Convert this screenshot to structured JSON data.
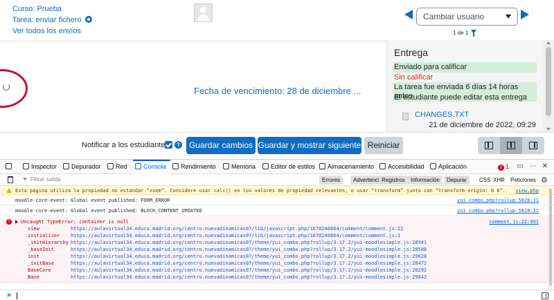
{
  "header": {
    "course_link": "Curso: Prueba",
    "task_link": "Tarea: enviar fichero",
    "view_all_link": "Ver todos los envíos",
    "change_user_placeholder": "Cambiar usuario",
    "pager_text": "1 de 1"
  },
  "submission": {
    "due_date": "Fecha de vencimiento: 28 de diciembre ...",
    "panel_title": "Entrega",
    "status_sent": "Enviado para calificar",
    "status_ungraded": "Sin calificar",
    "status_late": "La tarea fue enviada 6 días 14 horas antes",
    "status_editable": "El estudiante puede editar esta entrega",
    "file_name": "CHANGES.TXT",
    "file_date": "21 de diciembre de 2022, 09:29"
  },
  "actions": {
    "notify_label": "Notificar a los estudiantes",
    "notify_checked": true,
    "help_glyph": "?",
    "save_label": "Guardar cambios",
    "save_next_label": "Guardar y mostrar siguiente",
    "reset_label": "Reiniciar"
  },
  "devtools": {
    "tabs": {
      "inspector": "Inspector",
      "debugger": "Depurador",
      "network": "Red",
      "console": "Consola",
      "performance": "Rendimiento",
      "memory": "Memoria",
      "style_editor": "Editor de estilos",
      "storage": "Almacenamiento",
      "accessibility": "Accesibilidad",
      "application": "Aplicación"
    },
    "error_count": "1",
    "filter_placeholder": "Filtrar salida",
    "filter_toggles": {
      "errors": "Errores",
      "warnings": "Advertencias",
      "logs": "Registros",
      "info": "Información",
      "debug": "Depurar",
      "css": "CSS",
      "xhr": "XHR",
      "requests": "Peticiones"
    },
    "messages": {
      "warning_text": "Esta página utiliza la propiedad no estándar “zoom”. Considere usar calc() en los valores de propiedad relevantes, o usar “transform” junto con “transform-origin: 0 0”.",
      "warning_source": "view.php",
      "log1_text": "moodle-core-event: Global event published: FORM_ERROR",
      "log1_source": "yui_combo.php?rollup:5828:31",
      "log2_text": "moodle-core-event: Global event published: BLOCK_CONTENT_UPDATED",
      "log2_source": "yui_combo.php?rollup:5828:31",
      "error_text": "Uncaught TypeError: container is null",
      "error_source": "comment.js:22:991"
    },
    "stack_trace": [
      {
        "fn": "view",
        "url": "https://aulavirtual34.educa.madrid.org/centro.nuevadinamicas07/lib/javascript.php/1670240664/comment/comment.js:22"
      },
      {
        "fn": "initializer",
        "url": "https://aulavirtual34.educa.madrid.org/centro.nuevadinamicas07/lib/javascript.php/1670240664/comment/comment.js:1"
      },
      {
        "fn": "_initHierarchy",
        "url": "https://aulavirtual34.educa.madrid.org/centro.nuevadinamicas07/theme/yui_combo.php?rollup/3.17.2/yui-moodlesimple.js:28941"
      },
      {
        "fn": "_baseInit",
        "url": "https://aulavirtual34.educa.madrid.org/centro.nuevadinamicas07/theme/yui_combo.php?rollup/3.17.2/yui-moodlesimple.js:28508"
      },
      {
        "fn": "init",
        "url": "https://aulavirtual34.educa.madrid.org/centro.nuevadinamicas07/theme/yui_combo.php?rollup/3.17.2/yui-moodlesimple.js:29628"
      },
      {
        "fn": "_initBase",
        "url": "https://aulavirtual34.educa.madrid.org/centro.nuevadinamicas07/theme/yui_combo.php?rollup/3.17.2/yui-moodlesimple.js:28472"
      },
      {
        "fn": "BaseCore",
        "url": "https://aulavirtual34.educa.madrid.org/centro.nuevadinamicas07/theme/yui_combo.php?rollup/3.17.2/yui-moodlesimple.js:28292"
      },
      {
        "fn": "Base",
        "url": "https://aulavirtual34.educa.madrid.org/centro.nuevadinamicas07/theme/yui_combo.php?rollup/3.17.2/yui-moodlesimple.js:29842"
      }
    ],
    "prompt_glyph": "»"
  },
  "colors": {
    "brand": "#0f6cbf",
    "status_green": "#d4edda",
    "status_red": "#ca3120",
    "annotation_circle": "#c8102e",
    "devtools_accent": "#0060df"
  },
  "icons": [
    "settings-gear-icon",
    "user-avatar-icon",
    "previous-arrow-icon",
    "next-arrow-icon",
    "filter-icon",
    "loading-spinner-icon",
    "file-icon",
    "help-icon"
  ]
}
